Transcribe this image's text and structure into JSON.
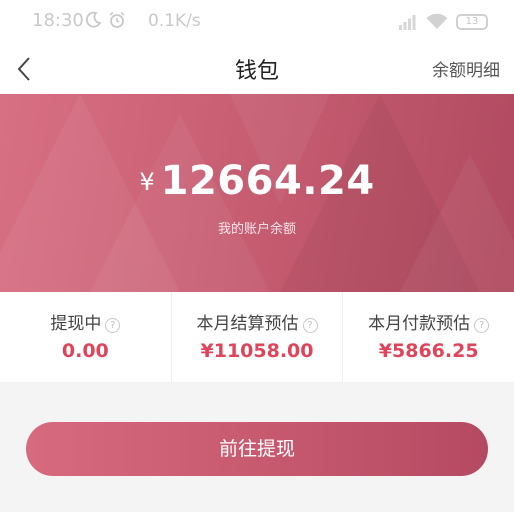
{
  "status_bar": {
    "time": "18:30",
    "network_speed": "0.1K/s",
    "battery": "13",
    "icons": [
      "moon-icon",
      "alarm-icon",
      "signal-icon",
      "wifi-icon",
      "battery-icon"
    ]
  },
  "nav": {
    "title": "钱包",
    "right_link": "余额明细",
    "back_icon": "chevron-left-icon"
  },
  "balance": {
    "currency": "¥",
    "amount": "12664.24",
    "caption": "我的账户余额"
  },
  "stats": [
    {
      "label": "提现中",
      "value": "0.00",
      "help_icon": "question-icon"
    },
    {
      "label": "本月结算预估",
      "value": "¥11058.00",
      "help_icon": "question-icon"
    },
    {
      "label": "本月付款预估",
      "value": "¥5866.25",
      "help_icon": "question-icon"
    }
  ],
  "help_glyph": "?",
  "actions": {
    "withdraw": "前往提现"
  },
  "colors": {
    "accent": "#e0445a",
    "banner_start": "#d87084",
    "banner_end": "#b04a60"
  }
}
